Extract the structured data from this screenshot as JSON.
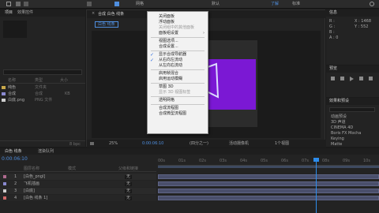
{
  "topbar": {
    "tabs": [
      "网格",
      "默认",
      "了解",
      "标准",
      "了解",
      "标准"
    ],
    "search": "搜索帮助"
  },
  "project_panel": {
    "title": "项目",
    "tab_effects": "效果控件",
    "name_header": "名称",
    "type_header": "类型",
    "size_header": "大小",
    "items": [
      {
        "name": "纯色",
        "type": "文件夹",
        "size": ""
      },
      {
        "name": "合成",
        "type": "合成",
        "size": "KB"
      },
      {
        "name": "白底.png",
        "type": "PNG 文件",
        "size": "KB"
      }
    ],
    "footer": "8 bpc"
  },
  "comp_panel": {
    "tab_label": "合成 白色 线条",
    "breadcrumb": "白色 线条",
    "zoom": "25%",
    "time": "0:00:06:10",
    "quality": "(四分之一)",
    "camera": "活动摄像机",
    "views": "1个视图"
  },
  "context_menu": {
    "items": [
      {
        "label": "关闭面板",
        "checked": false,
        "disabled": false
      },
      {
        "label": "浮动面板",
        "checked": false,
        "disabled": false
      },
      {
        "label": "关闭组中的其他面板",
        "checked": false,
        "disabled": true
      },
      {
        "label": "面板组设置",
        "checked": false,
        "disabled": false,
        "submenu": true
      },
      {
        "sep": true
      },
      {
        "label": "视图选项...",
        "checked": false,
        "disabled": false
      },
      {
        "label": "合成设置...",
        "checked": false,
        "disabled": false
      },
      {
        "sep": true
      },
      {
        "label": "显示合成导航器",
        "checked": true,
        "disabled": false
      },
      {
        "label": "从右向左流动",
        "checked": true,
        "disabled": false
      },
      {
        "label": "从左向右流动",
        "checked": false,
        "disabled": false
      },
      {
        "sep": true
      },
      {
        "label": "启用帧混合",
        "checked": false,
        "disabled": false
      },
      {
        "label": "启用运动模糊",
        "checked": false,
        "disabled": false
      },
      {
        "sep": true
      },
      {
        "label": "草图 3D",
        "checked": false,
        "disabled": false
      },
      {
        "label": "显示 3D 视图标签",
        "checked": false,
        "disabled": true
      },
      {
        "sep": true
      },
      {
        "label": "透明网格",
        "checked": false,
        "disabled": false
      },
      {
        "sep": true
      },
      {
        "label": "合成流程图",
        "checked": false,
        "disabled": false
      },
      {
        "label": "合成微型流程图",
        "checked": false,
        "disabled": false
      }
    ]
  },
  "info_panel": {
    "title": "信息",
    "r": "R :",
    "g": "G :",
    "b": "B :",
    "a": "A : 0",
    "x": "X : 1468",
    "y": "Y : 552",
    "preview_title": "预览",
    "effects_title": "效果和预设",
    "effects_items": [
      "动画预设",
      "3D 声道",
      "CINEMA 4D",
      "Boris FX Mocha",
      "Keying",
      "Matte"
    ]
  },
  "timeline": {
    "tab_label": "白色 线条",
    "tab_render": "渲染队列",
    "time": "0:00:06:10",
    "col_source": "图层名称",
    "col_mode": "模式",
    "col_parent": "父级和链接",
    "parent_none": "无",
    "layers": [
      {
        "num": "1",
        "name": "[白色_pngl]",
        "color": "#b06b8f"
      },
      {
        "num": "2",
        "name": "飞机插画",
        "color": "#8a8ad0"
      },
      {
        "num": "3",
        "name": "[白底]",
        "color": "#cfcfcf"
      },
      {
        "num": "4",
        "name": "[白色 线条 1]",
        "color": "#d06a6a"
      }
    ],
    "ruler": [
      "00s",
      "01s",
      "02s",
      "03s",
      "04s",
      "05s",
      "06s",
      "07s",
      "08s",
      "09s",
      "10s"
    ]
  },
  "colors": {
    "accent": "#2d8ceb",
    "purple": "#7b18d4",
    "menu_bg": "#f2f2f2",
    "panel_bg": "#232323"
  }
}
